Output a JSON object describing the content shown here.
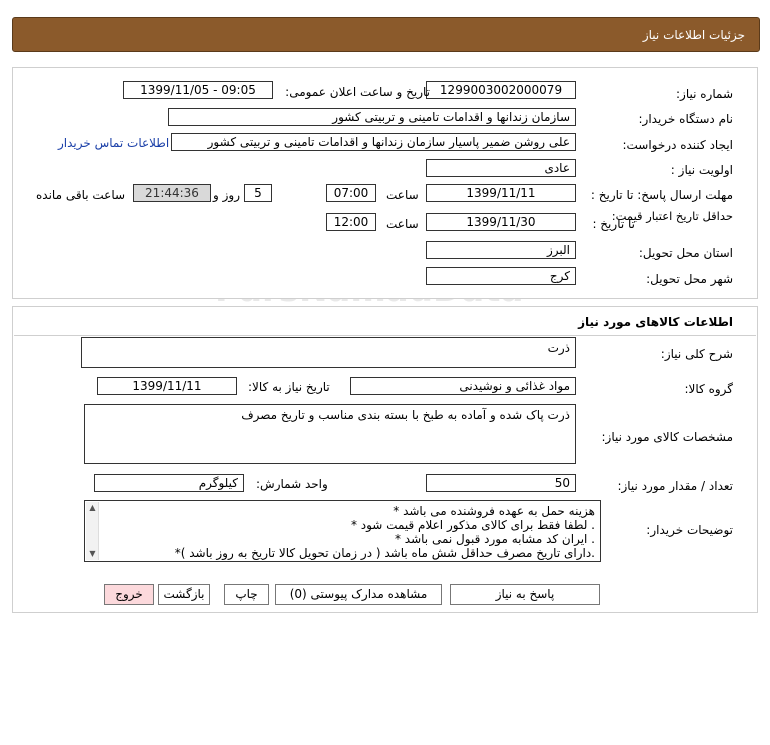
{
  "page_title": "جزئیات اطلاعات نیاز",
  "need_info": {
    "need_number_label": "شماره نیاز:",
    "need_number": "1299003002000079",
    "announce_label": "تاریخ و ساعت اعلان عمومی:",
    "announce_value": "1399/11/05 - 09:05",
    "buyer_org_label": "نام دستگاه خریدار:",
    "buyer_org": "سازمان زندانها و اقدامات تامینی و تربیتی کشور",
    "creator_label": "ایجاد کننده درخواست:",
    "creator": "علی روشن ضمیر پاسیار سازمان زندانها و اقدامات تامینی و تربیتی کشور",
    "contact_link": "اطلاعات تماس خریدار",
    "priority_label": "اولویت نیاز :",
    "priority": "عادی",
    "send_deadline_label": "مهلت ارسال پاسخ:  تا تاریخ :",
    "send_deadline_date": "1399/11/11",
    "time_label": "ساعت",
    "send_deadline_time": "07:00",
    "days_value": "5",
    "days_label": "روز و",
    "remaining_time": "21:44:36",
    "remaining_label": "ساعت باقی مانده",
    "validity_label": "حداقل تاریخ اعتبار قیمت:",
    "validity_to_label": "تا تاریخ :",
    "validity_date": "1399/11/30",
    "validity_time_label": "ساعت",
    "validity_time": "12:00",
    "province_label": "استان محل تحویل:",
    "province": "البرز",
    "city_label": "شهر محل تحویل:",
    "city": "کرج"
  },
  "goods": {
    "section_title": "اطلاعات کالاهای مورد نیاز",
    "general_desc_label": "شرح کلی نیاز:",
    "general_desc": "ذرت",
    "group_label": "گروه کالا:",
    "group": "مواد غذائی و نوشیدنی",
    "need_date_label": "تاریخ نیاز به کالا:",
    "need_date": "1399/11/11",
    "specs_label": "مشخصات کالای مورد نیاز:",
    "specs": "ذرت پاک شده و آماده به طبخ با بسته بندی مناسب و تاریخ مصرف",
    "qty_label": "تعداد / مقدار مورد نیاز:",
    "qty": "50",
    "unit_label": "واحد شمارش:",
    "unit": "کیلوگرم",
    "notes_label": "توضیحات خریدار:",
    "notes": [
      "هزینه حمل به عهده فروشنده می باشد *",
      ". لطفا فقط برای کالای مذکور اعلام قیمت شود *",
      ". ایران کد مشابه مورد قبول نمی باشد *",
      ".دارای تاریخ مصرف حداقل شش ماه باشد ( در زمان تحویل کالا تاریخ به روز باشد )*"
    ]
  },
  "buttons": {
    "reply": "پاسخ به نیاز",
    "attachments": "مشاهده مدارک پیوستی (0)",
    "print": "چاپ",
    "back": "بازگشت",
    "exit": "خروج"
  },
  "watermark": {
    "line1": "ParsNamadData",
    "line2": "مرکز فرآوری اطلاعات پارس نماد داده ها",
    "line3": "پایگاه اطلاع رسانی مناقصه و مزایده",
    "line4": "۰۲۱-۸۸۳۴۹۶۷۰"
  },
  "colors": {
    "title_bar": "#8b5a2b",
    "link": "#1a3fa8",
    "exit_button": "#fcd9dc"
  }
}
